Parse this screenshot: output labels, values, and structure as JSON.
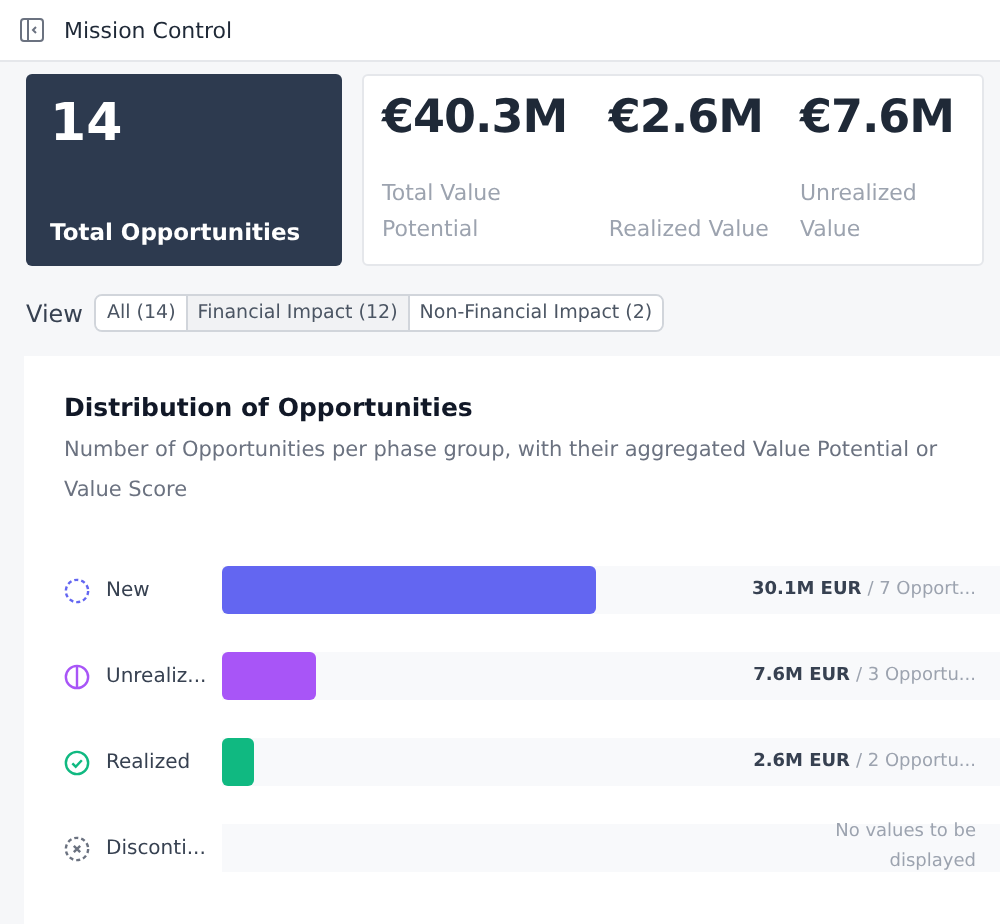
{
  "header": {
    "title": "Mission Control"
  },
  "summary": {
    "count": "14",
    "count_label": "Total Opportunities",
    "metrics": [
      {
        "value": "€40.3M",
        "label": "Total Value Potential"
      },
      {
        "value": "€2.6M",
        "label": "Realized Value"
      },
      {
        "value": "€7.6M",
        "label": "Unrealized Value"
      }
    ]
  },
  "view": {
    "label": "View",
    "tabs": [
      {
        "label": "All (14)",
        "selected": false
      },
      {
        "label": "Financial Impact (12)",
        "selected": true
      },
      {
        "label": "Non-Financial Impact (2)",
        "selected": false
      }
    ]
  },
  "distribution": {
    "title": "Distribution of Opportunities",
    "description": "Number of Opportunities per phase group, with their aggregated Value Potential or Value Score",
    "rows": [
      {
        "kind": "new",
        "label": "New",
        "color": "#6366f1",
        "level": 0.48,
        "amount": "30.1M EUR",
        "count": "/ 7 Opport..."
      },
      {
        "kind": "unrealized",
        "label": "Unrealiz...",
        "color": "#a855f7",
        "level": 0.12,
        "amount": "7.6M EUR",
        "count": "/ 3 Opportu..."
      },
      {
        "kind": "realized",
        "label": "Realized",
        "color": "#10b981",
        "level": 0.04,
        "amount": "2.6M EUR",
        "count": "/ 2 Opportu..."
      },
      {
        "kind": "discontinued",
        "label": "Disconti...",
        "color": "#6b7280",
        "empty_text": "No values to be displayed"
      }
    ]
  }
}
